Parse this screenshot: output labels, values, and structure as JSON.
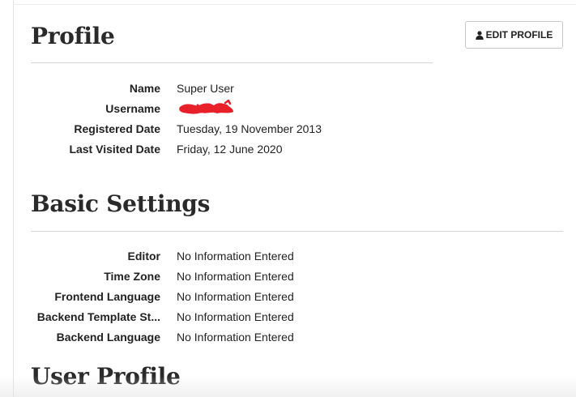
{
  "profile": {
    "title": "Profile",
    "edit_button_label": "EDIT PROFILE",
    "edit_button_icon": "user-icon",
    "fields": [
      {
        "label": "Name",
        "value": "Super User"
      },
      {
        "label": "Username",
        "value": ""
      },
      {
        "label": "Registered Date",
        "value": "Tuesday, 19 November 2013"
      },
      {
        "label": "Last Visited Date",
        "value": "Friday, 12 June 2020"
      }
    ],
    "redaction_color": "#e8202a"
  },
  "basic_settings": {
    "title": "Basic Settings",
    "fields": [
      {
        "label": "Editor",
        "value": "No Information Entered"
      },
      {
        "label": "Time Zone",
        "value": "No Information Entered"
      },
      {
        "label": "Frontend Language",
        "value": "No Information Entered"
      },
      {
        "label": "Backend Template St...",
        "value": "No Information Entered"
      },
      {
        "label": "Backend Language",
        "value": "No Information Entered"
      }
    ]
  },
  "user_profile": {
    "title": "User Profile"
  }
}
